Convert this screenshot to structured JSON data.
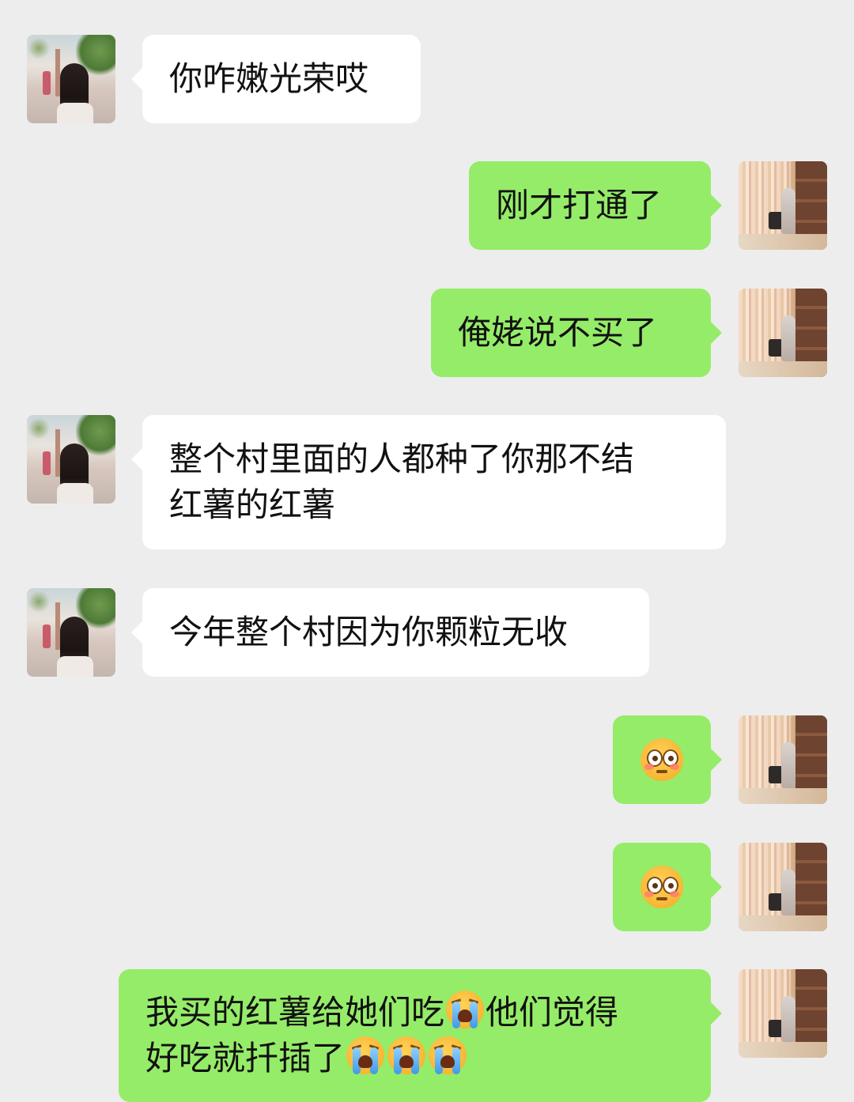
{
  "messages": [
    {
      "sender": "other",
      "lines": [
        "你咋嫩光荣哎"
      ]
    },
    {
      "sender": "me",
      "lines": [
        "刚才打通了"
      ]
    },
    {
      "sender": "me",
      "lines": [
        "俺姥说不买了"
      ]
    },
    {
      "sender": "other",
      "lines": [
        "整个村里面的人都种了你那不结",
        "红薯的红薯"
      ]
    },
    {
      "sender": "other",
      "lines": [
        "今年整个村因为你颗粒无收"
      ]
    },
    {
      "sender": "me",
      "emoji": "flushed-face-emoji"
    },
    {
      "sender": "me",
      "emoji": "flushed-face-emoji"
    },
    {
      "sender": "me",
      "line1": {
        "a": "我买的红薯给她们吃",
        "emoji": "loudly-crying-face-emoji",
        "b": "他们觉得"
      },
      "line2": {
        "a": "好吃就扦插了",
        "emojis": [
          "loudly-crying-face-emoji",
          "loudly-crying-face-emoji",
          "loudly-crying-face-emoji"
        ]
      }
    }
  ],
  "colors": {
    "background": "#ededed",
    "incoming_bubble": "#ffffff",
    "outgoing_bubble": "#95ec69"
  },
  "avatars": {
    "other": "street-photo-avatar",
    "me": "bookstore-photo-avatar"
  }
}
